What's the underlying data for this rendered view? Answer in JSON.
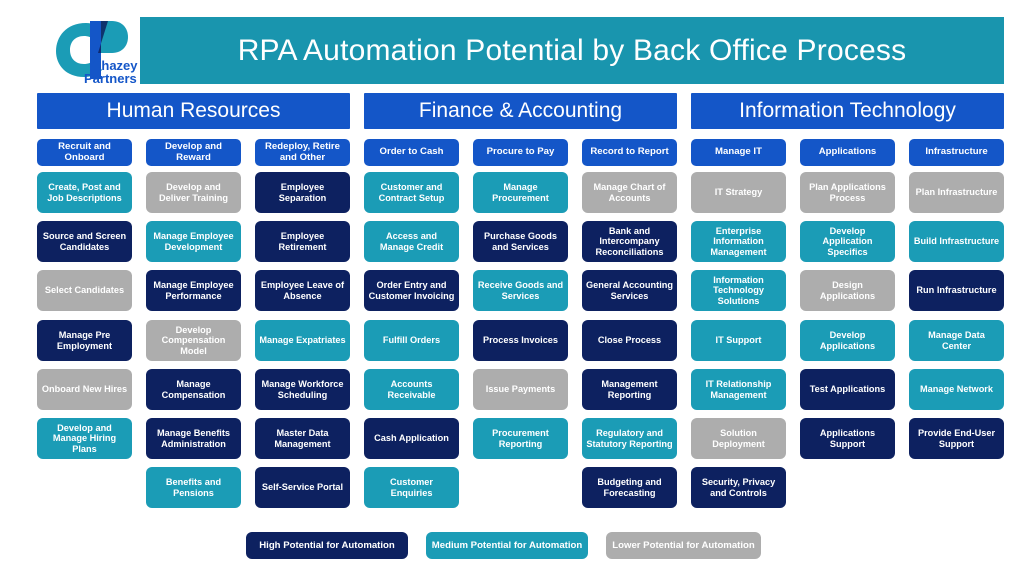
{
  "header": {
    "title": "RPA Automation Potential by Back Office Process",
    "band_color": "#1995ae",
    "logo": {
      "name": "chazey-partners-logo",
      "line1": "Chazey",
      "line2": "Partners"
    }
  },
  "legend_colors": {
    "high": "#0d2160",
    "medium": "#1b9cb6",
    "lower": "#adadad",
    "category": "#1456c8"
  },
  "pillars": [
    {
      "id": "hr",
      "label": "Human Resources"
    },
    {
      "id": "fa",
      "label": "Finance & Accounting"
    },
    {
      "id": "it",
      "label": "Information Technology"
    }
  ],
  "columns": [
    {
      "pillar": "hr",
      "header": "Recruit and Onboard",
      "items": [
        {
          "label": "Create, Post and Job Descriptions",
          "level": "medium"
        },
        {
          "label": "Source and Screen Candidates",
          "level": "high"
        },
        {
          "label": "Select Candidates",
          "level": "lower"
        },
        {
          "label": "Manage Pre Employment",
          "level": "high"
        },
        {
          "label": "Onboard New Hires",
          "level": "lower"
        },
        {
          "label": "Develop and Manage Hiring Plans",
          "level": "medium"
        }
      ]
    },
    {
      "pillar": "hr",
      "header": "Develop and Reward",
      "items": [
        {
          "label": "Develop and Deliver Training",
          "level": "lower"
        },
        {
          "label": "Manage Employee Development",
          "level": "medium"
        },
        {
          "label": "Manage Employee Performance",
          "level": "high"
        },
        {
          "label": "Develop Compensation Model",
          "level": "lower"
        },
        {
          "label": "Manage Compensation",
          "level": "high"
        },
        {
          "label": "Manage Benefits Administration",
          "level": "high"
        },
        {
          "label": "Benefits and Pensions",
          "level": "medium"
        }
      ]
    },
    {
      "pillar": "hr",
      "header": "Redeploy, Retire and Other",
      "items": [
        {
          "label": "Employee Separation",
          "level": "high"
        },
        {
          "label": "Employee Retirement",
          "level": "high"
        },
        {
          "label": "Employee Leave of Absence",
          "level": "high"
        },
        {
          "label": "Manage Expatriates",
          "level": "medium"
        },
        {
          "label": "Manage Workforce Scheduling",
          "level": "high"
        },
        {
          "label": "Master Data Management",
          "level": "high"
        },
        {
          "label": "Self-Service Portal",
          "level": "high"
        }
      ]
    },
    {
      "pillar": "fa",
      "header": "Order to Cash",
      "items": [
        {
          "label": "Customer and Contract Setup",
          "level": "medium"
        },
        {
          "label": "Access and Manage Credit",
          "level": "medium"
        },
        {
          "label": "Order Entry and Customer Invoicing",
          "level": "high"
        },
        {
          "label": "Fulfill Orders",
          "level": "medium"
        },
        {
          "label": "Accounts Receivable",
          "level": "medium"
        },
        {
          "label": "Cash Application",
          "level": "high"
        },
        {
          "label": "Customer Enquiries",
          "level": "medium"
        }
      ]
    },
    {
      "pillar": "fa",
      "header": "Procure to Pay",
      "items": [
        {
          "label": "Manage Procurement",
          "level": "medium"
        },
        {
          "label": "Purchase Goods and Services",
          "level": "high"
        },
        {
          "label": "Receive Goods and Services",
          "level": "medium"
        },
        {
          "label": "Process Invoices",
          "level": "high"
        },
        {
          "label": "Issue Payments",
          "level": "lower"
        },
        {
          "label": "Procurement Reporting",
          "level": "medium"
        }
      ]
    },
    {
      "pillar": "fa",
      "header": "Record to Report",
      "items": [
        {
          "label": "Manage Chart of Accounts",
          "level": "lower"
        },
        {
          "label": "Bank and Intercompany Reconciliations",
          "level": "high"
        },
        {
          "label": "General Accounting Services",
          "level": "high"
        },
        {
          "label": "Close Process",
          "level": "high"
        },
        {
          "label": "Management Reporting",
          "level": "high"
        },
        {
          "label": "Regulatory and Statutory Reporting",
          "level": "medium"
        },
        {
          "label": "Budgeting and Forecasting",
          "level": "high"
        }
      ]
    },
    {
      "pillar": "it",
      "header": "Manage IT",
      "items": [
        {
          "label": "IT Strategy",
          "level": "lower"
        },
        {
          "label": "Enterprise Information Management",
          "level": "medium"
        },
        {
          "label": "Information Technology Solutions",
          "level": "medium"
        },
        {
          "label": "IT Support",
          "level": "medium"
        },
        {
          "label": "IT Relationship Management",
          "level": "medium"
        },
        {
          "label": "Solution Deployment",
          "level": "lower"
        },
        {
          "label": "Security, Privacy and Controls",
          "level": "high"
        }
      ]
    },
    {
      "pillar": "it",
      "header": "Applications",
      "items": [
        {
          "label": "Plan Applications Process",
          "level": "lower"
        },
        {
          "label": "Develop Application Specifics",
          "level": "medium"
        },
        {
          "label": "Design Applications",
          "level": "lower"
        },
        {
          "label": "Develop Applications",
          "level": "medium"
        },
        {
          "label": "Test Applications",
          "level": "high"
        },
        {
          "label": "Applications Support",
          "level": "high"
        }
      ]
    },
    {
      "pillar": "it",
      "header": "Infrastructure",
      "items": [
        {
          "label": "Plan Infrastructure",
          "level": "lower"
        },
        {
          "label": "Build Infrastructure",
          "level": "medium"
        },
        {
          "label": "Run Infrastructure",
          "level": "high"
        },
        {
          "label": "Manage Data Center",
          "level": "medium"
        },
        {
          "label": "Manage Network",
          "level": "medium"
        },
        {
          "label": "Provide End-User Support",
          "level": "high"
        }
      ]
    }
  ],
  "legend": [
    {
      "label": "High Potential for Automation",
      "level": "high"
    },
    {
      "label": "Medium Potential for Automation",
      "level": "medium"
    },
    {
      "label": "Lower Potential for Automation",
      "level": "lower"
    }
  ]
}
